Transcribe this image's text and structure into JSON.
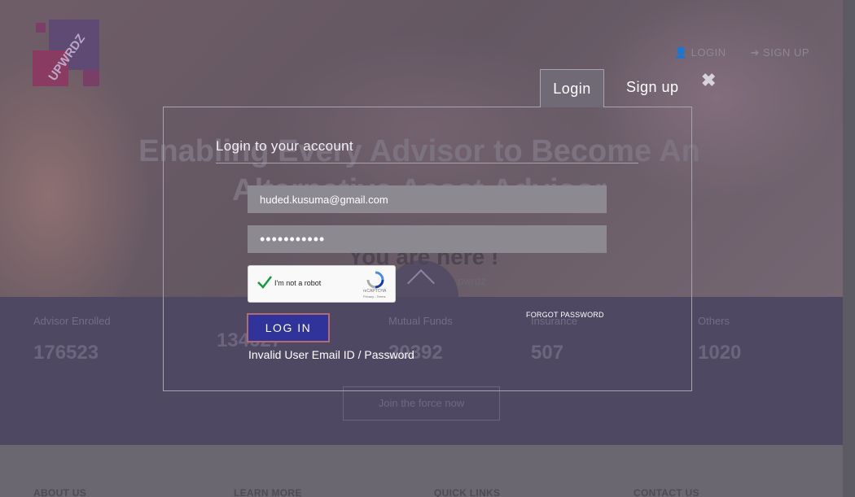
{
  "brand": {
    "logo_text": "UPWRDZ"
  },
  "top_nav": {
    "login": "LOGIN",
    "signup": "SIGN UP"
  },
  "hero": {
    "title": "Enabling Every Advisor to Become An Alternative Asset Advisor",
    "subtitle": "You are here !",
    "subtitle_small": "pwrdz"
  },
  "stats": [
    {
      "label": "Advisor Enrolled",
      "value": "176523"
    },
    {
      "label": "",
      "value": "134627"
    },
    {
      "label": "Mutual Funds",
      "value": "20392"
    },
    {
      "label": "Insurance",
      "value": "507"
    },
    {
      "label": "Others",
      "value": "1020"
    }
  ],
  "join_button": "Join the force now",
  "footer": [
    "ABOUT US",
    "LEARN MORE",
    "QUICK LINKS",
    "CONTACT US"
  ],
  "modal": {
    "tabs": {
      "login": "Login",
      "signup": "Sign up"
    },
    "close_glyph": "✖",
    "heading": "Login to your account",
    "email_value": "huded.kusuma@gmail.com",
    "password_mask": "•••••••••••",
    "captcha": {
      "label": "I'm not a robot",
      "brand": "reCAPTCHA",
      "terms": "Privacy - Terms"
    },
    "forgot_password": "FORGOT PASSWORD",
    "login_button": "LOG IN",
    "error": "Invalid User Email ID / Password"
  },
  "colors": {
    "button_bg": "#30339a",
    "button_border": "#b26b6f",
    "stats_bg": "#4f4863"
  }
}
